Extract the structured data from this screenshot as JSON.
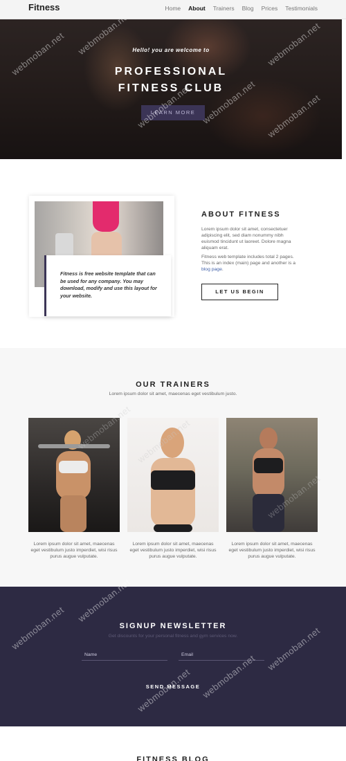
{
  "nav": {
    "brand": "Fitness",
    "items": [
      {
        "label": "Home",
        "active": false
      },
      {
        "label": "About",
        "active": true
      },
      {
        "label": "Trainers",
        "active": false
      },
      {
        "label": "Blog",
        "active": false
      },
      {
        "label": "Prices",
        "active": false
      },
      {
        "label": "Testimonials",
        "active": false
      }
    ]
  },
  "hero": {
    "greeting": "Hello! you are welcome to",
    "title_line1": "PROFESSIONAL",
    "title_line2": "FITNESS CLUB",
    "button": "LEARN MORE"
  },
  "about": {
    "title": "ABOUT FITNESS",
    "quote": "Fitness is free website template that can be used for any company. You may download, modify and use this layout for your website.",
    "para1": "Lorem ipsum dolor sit amet, consectetuer adipiscing elit, sed diam nonummy nibh euismod tincidunt ut laoreet. Dolore magna aliquam erat.",
    "para2_text": "Fitness web template includes total 2 pages. This is an index (main) page and another is a",
    "para2_link": "blog page",
    "para2_end": ".",
    "button": "LET US BEGIN"
  },
  "trainers": {
    "title": "OUR TRAINERS",
    "subtitle": "Lorem ipsum dolor sit amet, maecenas eget vestibulum justo.",
    "cards": [
      {
        "text": "Lorem ipsum dolor sit amet, maecenas eget vestibulum justo imperdiet, wisi risus purus augue vulputate."
      },
      {
        "text": "Lorem ipsum dolor sit amet, maecenas eget vestibulum justo imperdiet, wisi risus purus augue vulputate."
      },
      {
        "text": "Lorem ipsum dolor sit amet, maecenas eget vestibulum justo imperdiet, wisi risus purus augue vulputate."
      }
    ]
  },
  "newsletter": {
    "title": "SIGNUP NEWSLETTER",
    "subtitle": "Get discounts for your personal fitness and gym services now.",
    "name_placeholder": "Name",
    "email_placeholder": "Email",
    "button": "SEND MESSAGE"
  },
  "blog": {
    "title": "FITNESS BLOG"
  },
  "watermark": "webmoban.net",
  "colors": {
    "accent": "#3b3456",
    "newsletter_bg": "#2d2a43",
    "link": "#3f5fa8"
  }
}
